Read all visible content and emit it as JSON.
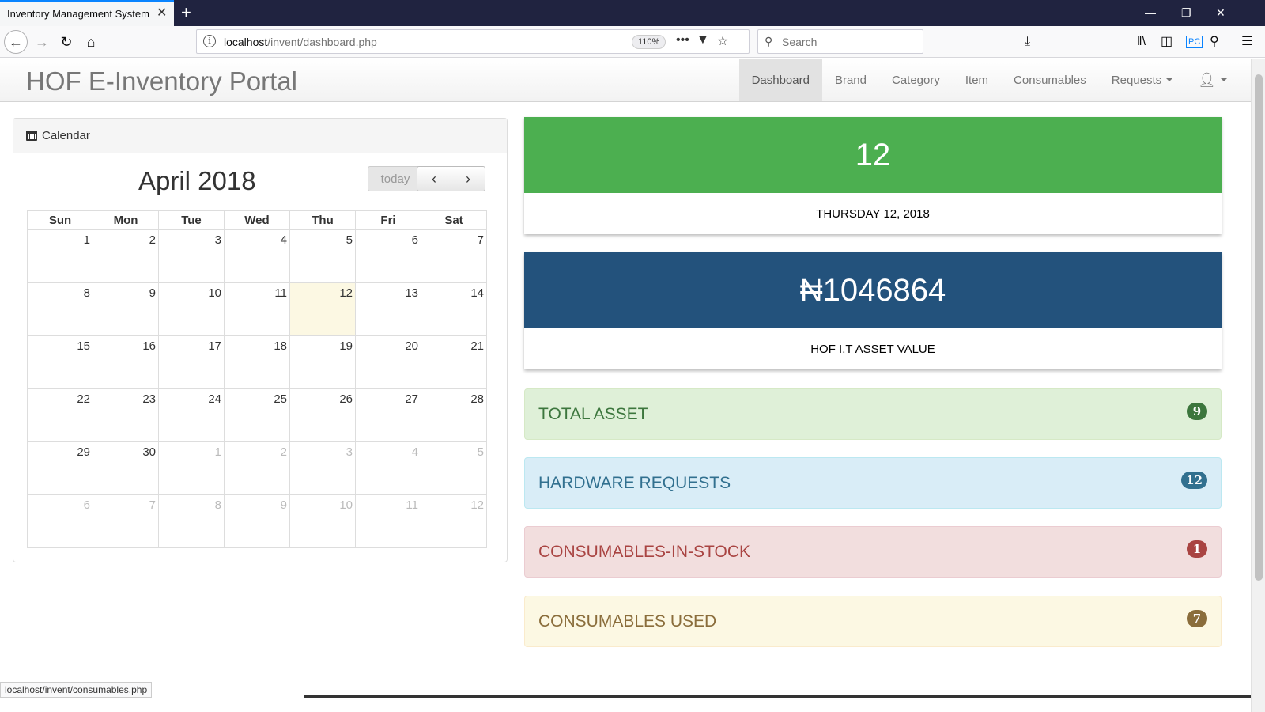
{
  "browser": {
    "tab_title": "Inventory Management System",
    "tab_close": "✕",
    "new_tab": "+",
    "url_host": "localhost",
    "url_path": "/invent/dashboard.php",
    "zoom": "110%",
    "search_placeholder": "Search",
    "status_url": "localhost/invent/consumables.php"
  },
  "app": {
    "brand": "HOF E-Inventory Portal",
    "menu": [
      "Dashboard",
      "Brand",
      "Category",
      "Item",
      "Consumables",
      "Requests"
    ]
  },
  "calendar": {
    "panel_title": "Calendar",
    "month_title": "April 2018",
    "today_label": "today",
    "prev": "‹",
    "next": "›",
    "weekdays": [
      "Sun",
      "Mon",
      "Tue",
      "Wed",
      "Thu",
      "Fri",
      "Sat"
    ],
    "weeks": [
      [
        "1",
        "2",
        "3",
        "4",
        "5",
        "6",
        "7"
      ],
      [
        "8",
        "9",
        "10",
        "11",
        "12",
        "13",
        "14"
      ],
      [
        "15",
        "16",
        "17",
        "18",
        "19",
        "20",
        "21"
      ],
      [
        "22",
        "23",
        "24",
        "25",
        "26",
        "27",
        "28"
      ],
      [
        "29",
        "30",
        "1",
        "2",
        "3",
        "4",
        "5"
      ],
      [
        "6",
        "7",
        "8",
        "9",
        "10",
        "11",
        "12"
      ]
    ]
  },
  "cards": {
    "date_number": "12",
    "date_text": "THURSDAY 12, 2018",
    "asset_value": "₦1046864",
    "asset_label": "HOF I.T ASSET VALUE"
  },
  "stats": [
    {
      "label": "TOTAL ASSET",
      "count": "9"
    },
    {
      "label": "HARDWARE REQUESTS",
      "count": "12"
    },
    {
      "label": "CONSUMABLES-IN-STOCK",
      "count": "1"
    },
    {
      "label": "CONSUMABLES USED",
      "count": "7"
    }
  ],
  "colors": {
    "date_card": "#4caf50",
    "asset_card": "#23527c",
    "success_bg": "#dff0d8",
    "info_bg": "#d9edf7",
    "danger_bg": "#f2dede",
    "warning_bg": "#fcf8e3"
  }
}
